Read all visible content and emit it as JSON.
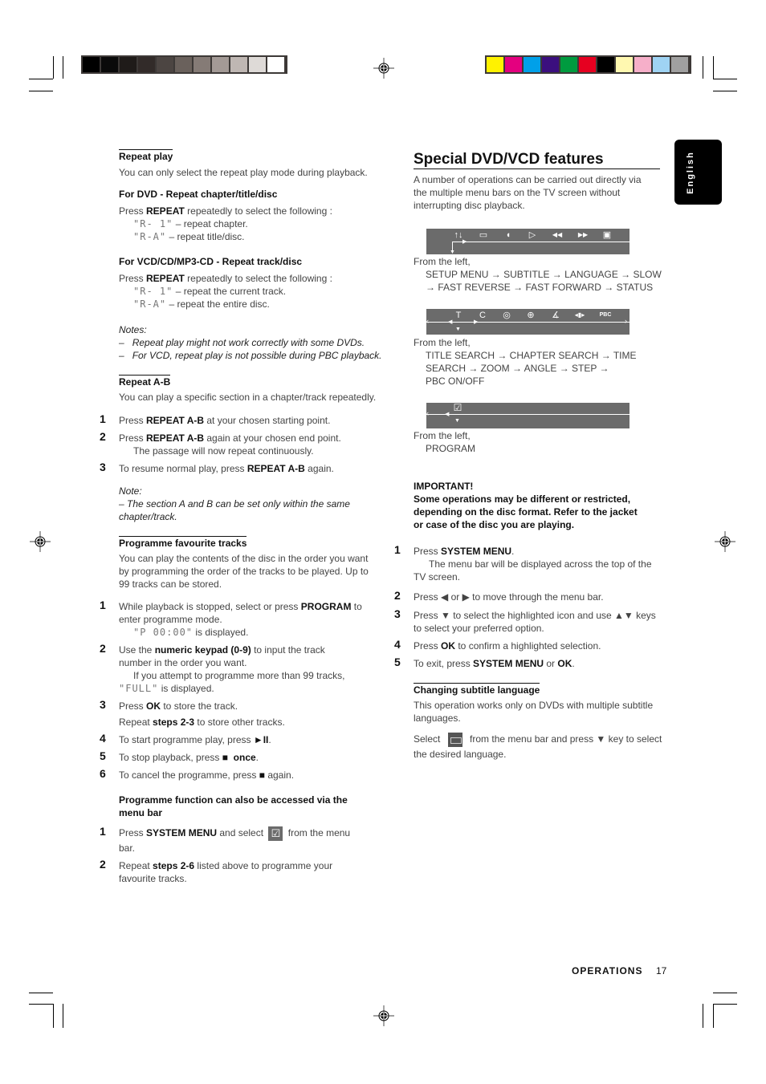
{
  "printer_marks": {
    "gray_swatches": [
      "#000000",
      "#0a0a0a",
      "#1f1b19",
      "#322b29",
      "#4c4542",
      "#6a615c",
      "#857b76",
      "#a39a96",
      "#bfb7b3",
      "#dedad7",
      "#ffffff"
    ],
    "color_swatches": [
      "#fff200",
      "#e4007f",
      "#00a0e9",
      "#3b0f7e",
      "#009b3f",
      "#e60020",
      "#000000",
      "#fff8b0",
      "#f6afc9",
      "#9fd3f3",
      "#a0a0a0"
    ]
  },
  "side_tab": {
    "label": "English"
  },
  "left": {
    "repeat_play": {
      "heading": "Repeat play",
      "intro": "You can only select the repeat play mode during playback.",
      "dvd": {
        "subheading": "For DVD - Repeat chapter/title/disc",
        "press_prefix": "Press ",
        "press_key": "REPEAT",
        "press_suffix": " repeatedly to select the following :",
        "options": [
          {
            "code": "\"R- 1\"",
            "desc": " – repeat chapter."
          },
          {
            "code": "\"R-A\"",
            "desc": " – repeat title/disc."
          }
        ]
      },
      "vcd": {
        "subheading": "For VCD/CD/MP3-CD - Repeat track/disc",
        "press_prefix": "Press ",
        "press_key": "REPEAT",
        "press_suffix": " repeatedly to select the following :",
        "options": [
          {
            "code": "\"R- 1\"",
            "desc": " – repeat the current track."
          },
          {
            "code": "\"R-A\"",
            "desc": " – repeat the entire disc."
          }
        ]
      },
      "notes_label": "Notes:",
      "notes": [
        "Repeat play might not work correctly with some DVDs.",
        "For VCD, repeat play is not possible during PBC playback."
      ]
    },
    "repeat_ab": {
      "heading": "Repeat A-B",
      "intro": "You can play a specific section in a chapter/track repeatedly.",
      "steps": [
        {
          "n": "1",
          "pre": "Press ",
          "key": "REPEAT A-B",
          "post": " at your chosen starting point."
        },
        {
          "n": "2",
          "pre": "Press ",
          "key": "REPEAT A-B",
          "post": " again at your chosen end point.",
          "sub": "The passage will now repeat continuously."
        },
        {
          "n": "3",
          "pre": "To resume normal play, press ",
          "key": "REPEAT A-B",
          "post": " again."
        }
      ],
      "note_label": "Note:",
      "note_line1": "–  The section A and B can be set only within the same",
      "note_line2": "chapter/track."
    },
    "programme": {
      "heading": "Programme favourite tracks",
      "intro_lines": [
        "You can play the contents of the disc in the order you want",
        "by programming the order of the tracks to be played. Up to",
        "99 tracks can be stored."
      ],
      "step1": {
        "n": "1",
        "pre": "While playback is stopped, select or press ",
        "key": "PROGRAM",
        "post": " to",
        "line2": "enter programme mode.",
        "lcd": "\"P 00:00\"",
        "lcd_post": "  is displayed."
      },
      "step2": {
        "n": "2",
        "pre": "Use the ",
        "key": "numeric keypad (0-9)",
        "post": " to input the track",
        "line2": "number in the order you want.",
        "line3": "If you attempt to programme more than 99 tracks,",
        "lcd": "\"FULL\"",
        "lcd_post": " is displayed."
      },
      "step3": {
        "n": "3",
        "pre": "Press ",
        "key": "OK",
        "post": " to store the track.",
        "line2_pre": "Repeat ",
        "line2_key": "steps 2-3",
        "line2_post": " to store other tracks."
      },
      "step4": {
        "n": "4",
        "pre": "To start programme play, press ",
        "key": "►II",
        "post": "."
      },
      "step5": {
        "n": "5",
        "pre": "To stop playback, press ",
        "key": "■",
        "key2": "once",
        "post": "."
      },
      "step6": {
        "n": "6",
        "pre": "To cancel the programme, press ",
        "key": "■",
        "post": " again."
      },
      "menubar_heading_line1": "Programme function can also be accessed via the",
      "menubar_heading_line2": "menu bar",
      "mb_step1": {
        "n": "1",
        "pre": "Press ",
        "key": "SYSTEM MENU",
        "mid": " and select ",
        "post": " from the menu",
        "line2": "bar."
      },
      "mb_step2": {
        "n": "2",
        "pre": "Repeat ",
        "key": "steps 2-6",
        "post": " listed above to programme your",
        "line2": "favourite tracks."
      }
    }
  },
  "right": {
    "title": "Special DVD/VCD features",
    "intro_lines": [
      "A number of operations can be carried out directly via",
      "the multiple menu bars on the TV screen without",
      "interrupting disc playback."
    ],
    "menubar1": {
      "icons": [
        "setup-menu",
        "subtitle",
        "language",
        "slow",
        "fast-reverse",
        "fast-forward",
        "status"
      ],
      "glyphs": [
        "↑↓",
        "▭",
        "◖",
        "▷",
        "◀◀",
        "▶▶",
        "▣"
      ],
      "from_left": "From the left,",
      "line1": "SETUP MENU → SUBTITLE → LANGUAGE → SLOW",
      "line2": "→ FAST REVERSE → FAST FORWARD → STATUS"
    },
    "menubar2": {
      "icons": [
        "title-search",
        "chapter-search",
        "time-search",
        "zoom",
        "angle",
        "step",
        "pbc"
      ],
      "glyphs": [
        "T",
        "C",
        "◎",
        "⊕",
        "∡",
        "◂▮▸",
        "PBC"
      ],
      "from_left": "From the left,",
      "line1": "TITLE SEARCH → CHAPTER SEARCH → TIME",
      "line2": "SEARCH → ZOOM → ANGLE → STEP →",
      "line3": "PBC ON/OFF"
    },
    "menubar3": {
      "icons": [
        "program"
      ],
      "glyphs": [
        "☑"
      ],
      "from_left": "From the left,",
      "line1": "PROGRAM"
    },
    "important": {
      "label": "IMPORTANT!",
      "lines": [
        "Some operations may be different or restricted,",
        "depending on the disc format. Refer to the jacket",
        "or case of the disc you are playing."
      ]
    },
    "steps": [
      {
        "n": "1",
        "html_pre": "Press ",
        "key": "SYSTEM MENU",
        "post": ".",
        "sub1": "The menu bar will be displayed across the top of the",
        "sub2": "TV screen."
      },
      {
        "n": "2",
        "html_pre": "Press ◀ or ▶ to move through the menu bar."
      },
      {
        "n": "3",
        "html_pre": "Press ▼ to select the highlighted icon and use  ▲▼  keys",
        "sub2": "to select your preferred option."
      },
      {
        "n": "4",
        "html_pre": "Press ",
        "key": "OK",
        "post": " to confirm a highlighted selection."
      },
      {
        "n": "5",
        "html_pre": "To exit, press ",
        "key": "SYSTEM MENU",
        "mid": " or ",
        "key2": "OK",
        "post": "."
      }
    ],
    "subtitle": {
      "heading": "Changing subtitle language",
      "line1": "This operation works only on DVDs with multiple subtitle",
      "line2": "languages.",
      "select_pre": "Select ",
      "select_post": " from the menu bar and press ▼ key to select",
      "line4": "the desired language."
    }
  },
  "footer": {
    "section": "OPERATIONS",
    "page": "17"
  }
}
